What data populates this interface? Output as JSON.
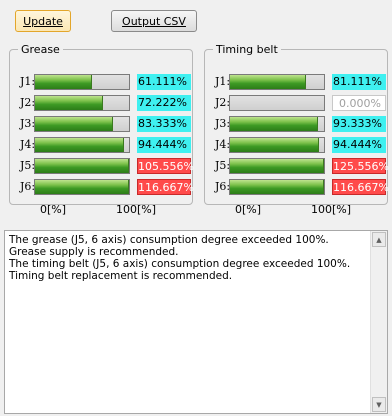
{
  "toolbar": {
    "update_label": "Update",
    "csv_label": "Output CSV"
  },
  "grease": {
    "title": "Grease",
    "rows": [
      {
        "label": "J1:",
        "value": "61.111%",
        "level": 0.61111,
        "state": "cyan"
      },
      {
        "label": "J2:",
        "value": "72.222%",
        "level": 0.72222,
        "state": "cyan"
      },
      {
        "label": "J3:",
        "value": "83.333%",
        "level": 0.83333,
        "state": "cyan"
      },
      {
        "label": "J4:",
        "value": "94.444%",
        "level": 0.94444,
        "state": "cyan"
      },
      {
        "label": "J5:",
        "value": "105.556%",
        "level": 1.0,
        "state": "red"
      },
      {
        "label": "J6:",
        "value": "116.667%",
        "level": 1.0,
        "state": "red"
      }
    ],
    "scale_min": "0[%]",
    "scale_max": "100[%]"
  },
  "belt": {
    "title": "Timing belt",
    "rows": [
      {
        "label": "J1:",
        "value": "81.111%",
        "level": 0.81111,
        "state": "cyan"
      },
      {
        "label": "J2:",
        "value": "0.000%",
        "level": 0.0,
        "state": "zero"
      },
      {
        "label": "J3:",
        "value": "93.333%",
        "level": 0.93333,
        "state": "cyan"
      },
      {
        "label": "J4:",
        "value": "94.444%",
        "level": 0.94444,
        "state": "cyan"
      },
      {
        "label": "J5:",
        "value": "125.556%",
        "level": 1.0,
        "state": "red"
      },
      {
        "label": "J6:",
        "value": "116.667%",
        "level": 1.0,
        "state": "red"
      }
    ],
    "scale_min": "0[%]",
    "scale_max": "100[%]"
  },
  "log": {
    "text": "The grease (J5, 6 axis) consumption degree exceeded 100%.\nGrease supply is recommended.\nThe timing belt (J5, 6 axis) consumption degree exceeded 100%.\nTiming belt replacement is recommended."
  },
  "colors": {
    "ok": "#3ff0f0",
    "over": "#ff4b4b",
    "bar_fill": "#3d9a24"
  },
  "icons": {
    "scroll_up": "scroll-up-arrow-icon",
    "scroll_down": "scroll-down-arrow-icon"
  }
}
